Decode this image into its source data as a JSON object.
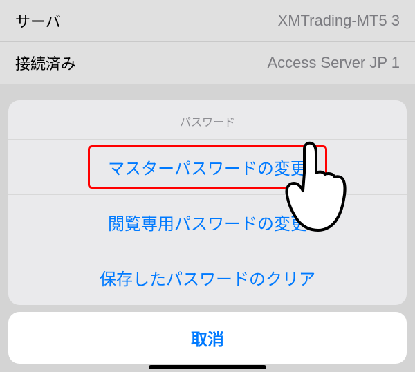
{
  "backgroundList": {
    "rows": [
      {
        "label": "サーバ",
        "value": "XMTrading-MT5 3"
      },
      {
        "label": "接続済み",
        "value": "Access Server JP 1"
      }
    ]
  },
  "actionSheet": {
    "title": "パスワード",
    "options": [
      "マスターパスワードの変更",
      "閲覧専用パスワードの変更",
      "保存したパスワードのクリア"
    ],
    "cancel": "取消"
  }
}
